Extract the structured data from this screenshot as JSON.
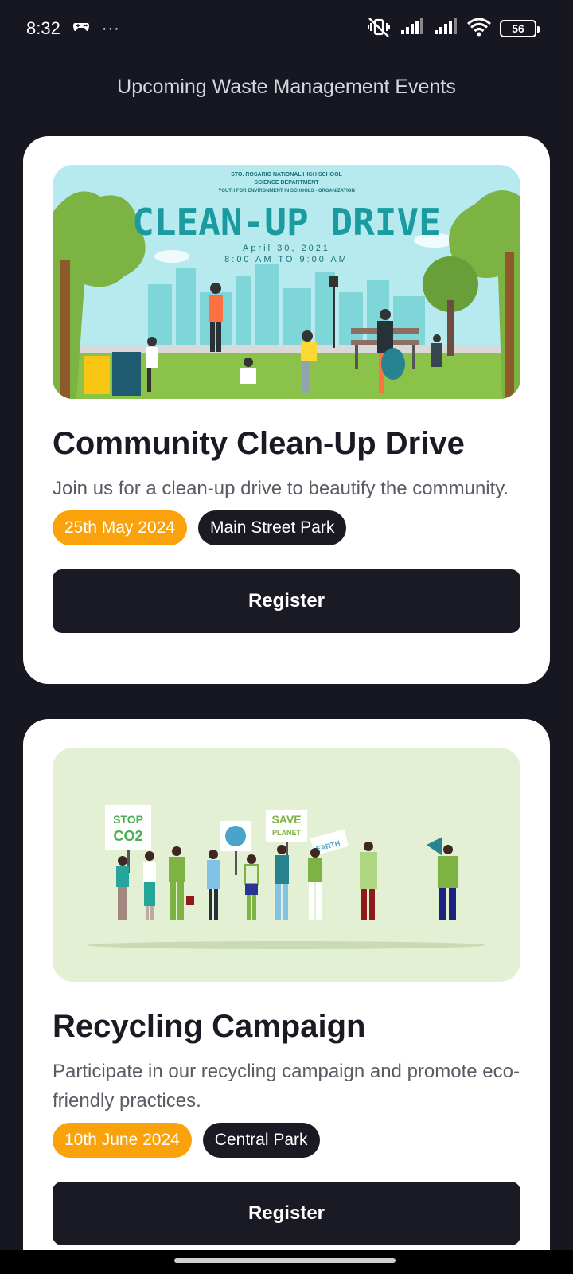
{
  "status_bar": {
    "time": "8:32",
    "more": "···",
    "battery": "56"
  },
  "header": {
    "title": "Upcoming Waste Management Events"
  },
  "events": [
    {
      "poster": {
        "school": "STO. ROSARIO NATIONAL HIGH SCHOOL",
        "department": "SCIENCE DEPARTMENT",
        "organization": "YOUTH FOR ENVIRONMENT IN SCHOOLS - ORGANIZATION",
        "headline": "CLEAN-UP DRIVE",
        "date": "April 30, 2021",
        "time": "8:00 AM TO 9:00 AM"
      },
      "title": "Community Clean-Up Drive",
      "description": "Join us for a clean-up drive to beautify the community.",
      "date": "25th May 2024",
      "location": "Main Street Park",
      "button": "Register"
    },
    {
      "poster": {
        "sign_1_line_1": "STOP",
        "sign_1_line_2": "CO2",
        "sign_2_line_1": "SAVE",
        "sign_2_line_2": "PLANET",
        "sign_3": "EARTH"
      },
      "title": "Recycling Campaign",
      "description": "Participate in our recycling campaign and promote eco-friendly practices.",
      "date": "10th June 2024",
      "location": "Central Park",
      "button": "Register"
    }
  ],
  "colors": {
    "background": "#171722",
    "card": "#ffffff",
    "accent": "#f9a20b",
    "dark": "#1a1a24"
  }
}
